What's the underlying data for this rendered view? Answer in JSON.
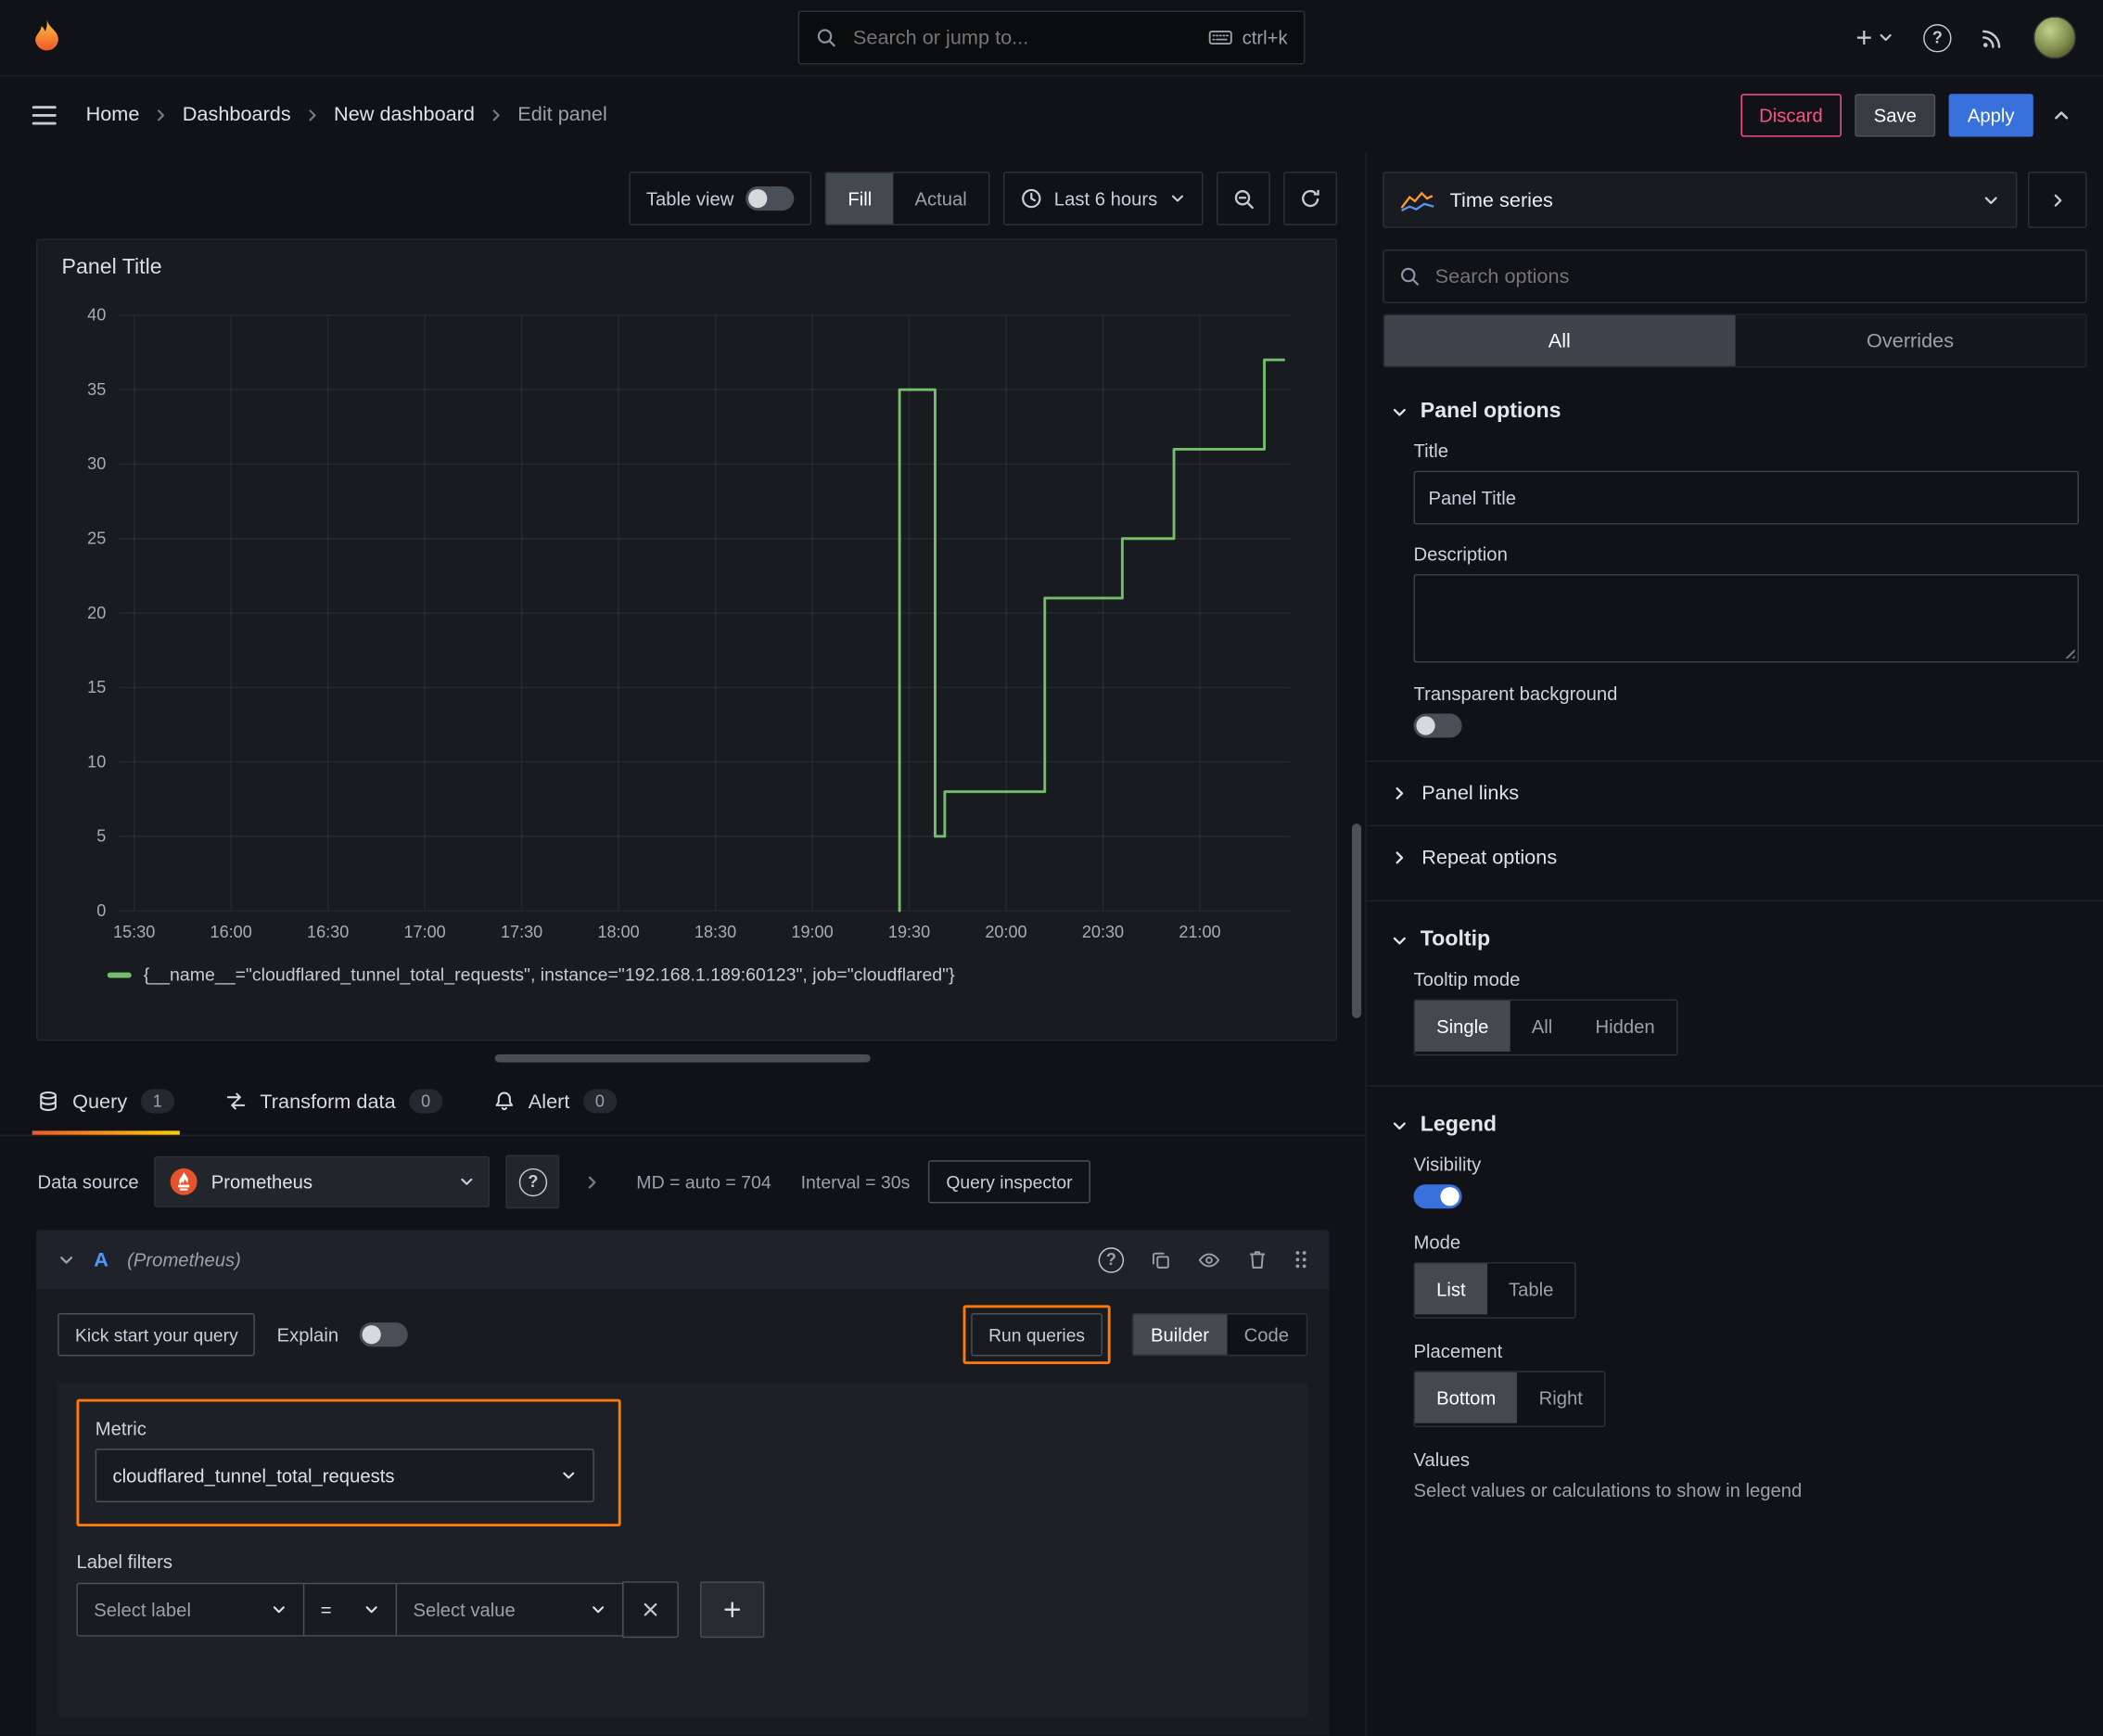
{
  "theme": {
    "orange": "#ff780a",
    "green": "#73bf69",
    "blue": "#3871dc",
    "red": "#ff5286"
  },
  "topbar": {
    "search_placeholder": "Search or jump to...",
    "shortcut": "ctrl+k"
  },
  "nav": {
    "breadcrumbs": [
      "Home",
      "Dashboards",
      "New dashboard",
      "Edit panel"
    ],
    "discard": "Discard",
    "save": "Save",
    "apply": "Apply"
  },
  "panel_toolbar": {
    "table_view": "Table view",
    "fill": "Fill",
    "actual": "Actual",
    "time_range": "Last 6 hours"
  },
  "panel": {
    "title": "Panel Title",
    "legend": "{__name__=\"cloudflared_tunnel_total_requests\", instance=\"192.168.1.189:60123\", job=\"cloudflared\"}"
  },
  "chart_data": {
    "type": "line",
    "line_style": "step",
    "title": "Panel Title",
    "x_start": "15:25",
    "x_end": "21:28",
    "x_ticks": [
      "15:30",
      "16:00",
      "16:30",
      "17:00",
      "17:30",
      "18:00",
      "18:30",
      "19:00",
      "19:30",
      "20:00",
      "20:30",
      "21:00"
    ],
    "ylim": [
      0,
      40
    ],
    "y_ticks": [
      0,
      5,
      10,
      15,
      20,
      25,
      30,
      35,
      40
    ],
    "grid": true,
    "legend_position": "bottom",
    "series": [
      {
        "name": "{__name__=\"cloudflared_tunnel_total_requests\", instance=\"192.168.1.189:60123\", job=\"cloudflared\"}",
        "color": "#73bf69",
        "points": [
          [
            "19:27",
            0
          ],
          [
            "19:27",
            35
          ],
          [
            "19:38",
            35
          ],
          [
            "19:38",
            5
          ],
          [
            "19:41",
            5
          ],
          [
            "19:41",
            8
          ],
          [
            "20:12",
            8
          ],
          [
            "20:12",
            21
          ],
          [
            "20:36",
            21
          ],
          [
            "20:36",
            25
          ],
          [
            "20:52",
            25
          ],
          [
            "20:52",
            31
          ],
          [
            "21:20",
            31
          ],
          [
            "21:20",
            37
          ],
          [
            "21:26",
            37
          ]
        ]
      }
    ]
  },
  "query_section": {
    "tabs": [
      {
        "label": "Query",
        "count": "1"
      },
      {
        "label": "Transform data",
        "count": "0"
      },
      {
        "label": "Alert",
        "count": "0"
      }
    ],
    "datasource_label": "Data source",
    "datasource": "Prometheus",
    "stats_md": "MD = auto = 704",
    "stats_interval": "Interval = 30s",
    "inspector": "Query inspector",
    "ref_id": "A",
    "ds_hint": "(Prometheus)",
    "kick_start": "Kick start your query",
    "explain": "Explain",
    "run_queries": "Run queries",
    "mode_builder": "Builder",
    "mode_code": "Code",
    "metric_label": "Metric",
    "metric_value": "cloudflared_tunnel_total_requests",
    "label_filters": "Label filters",
    "select_label": "Select label",
    "operator": "=",
    "select_value": "Select value"
  },
  "sidebar": {
    "viz_type": "Time series",
    "search_placeholder": "Search options",
    "tab_all": "All",
    "tab_overrides": "Overrides",
    "panel_options": {
      "heading": "Panel options",
      "title_label": "Title",
      "title_value": "Panel Title",
      "description_label": "Description",
      "transparent_label": "Transparent background"
    },
    "panel_links": "Panel links",
    "repeat_options": "Repeat options",
    "tooltip": {
      "heading": "Tooltip",
      "mode_label": "Tooltip mode",
      "single": "Single",
      "all": "All",
      "hidden": "Hidden"
    },
    "legend": {
      "heading": "Legend",
      "visibility": "Visibility",
      "mode": "Mode",
      "list": "List",
      "table": "Table",
      "placement": "Placement",
      "bottom": "Bottom",
      "right": "Right",
      "values": "Values",
      "values_desc": "Select values or calculations to show in legend"
    }
  }
}
